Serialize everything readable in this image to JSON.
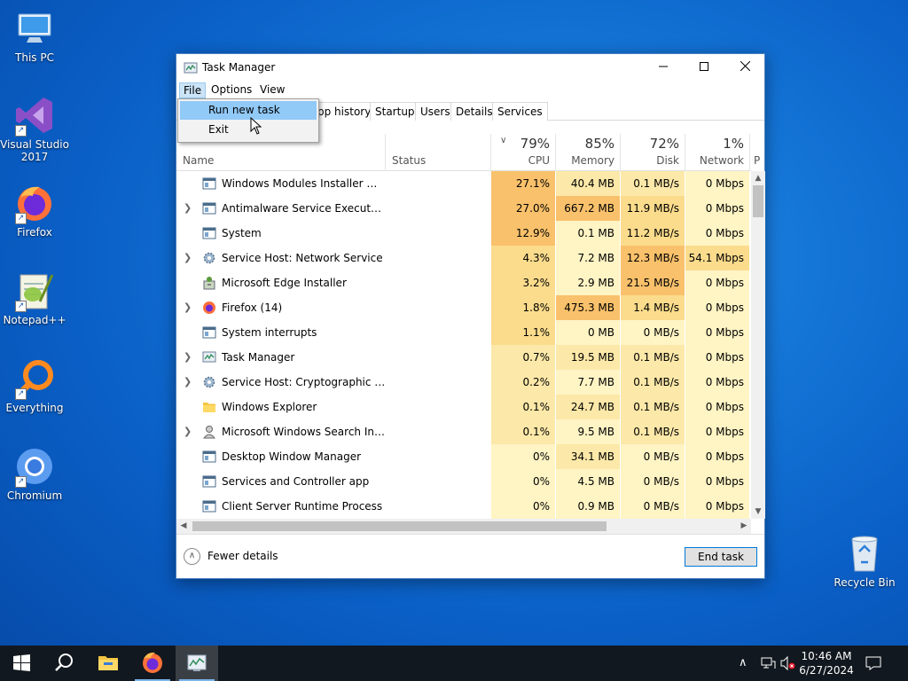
{
  "desktop": {
    "icons": [
      {
        "label": "This PC"
      },
      {
        "label": "Visual Studio 2017"
      },
      {
        "label": "Firefox"
      },
      {
        "label": "Notepad++"
      },
      {
        "label": "Everything"
      },
      {
        "label": "Chromium"
      },
      {
        "label": "Recycle Bin"
      }
    ]
  },
  "window": {
    "title": "Task Manager",
    "menu": {
      "file": "File",
      "options": "Options",
      "view": "View"
    },
    "tabs": [
      "pp history",
      "Startup",
      "Users",
      "Details",
      "Services"
    ],
    "columns": {
      "name": "Name",
      "status": "Status",
      "cpu": {
        "pct": "79%",
        "label": "CPU"
      },
      "memory": {
        "pct": "85%",
        "label": "Memory"
      },
      "disk": {
        "pct": "72%",
        "label": "Disk"
      },
      "network": {
        "pct": "1%",
        "label": "Network"
      },
      "power_partial": "P"
    },
    "processes": [
      {
        "name": "Windows Modules Installer Wor...",
        "expandable": false,
        "icon": "service-window-icon",
        "cpu": "27.1%",
        "memory": "40.4 MB",
        "disk": "0.1 MB/s",
        "network": "0 Mbps"
      },
      {
        "name": "Antimalware Service Executable",
        "expandable": true,
        "icon": "service-window-icon",
        "cpu": "27.0%",
        "memory": "667.2 MB",
        "disk": "11.9 MB/s",
        "network": "0 Mbps"
      },
      {
        "name": "System",
        "expandable": false,
        "icon": "service-window-icon",
        "cpu": "12.9%",
        "memory": "0.1 MB",
        "disk": "11.2 MB/s",
        "network": "0 Mbps"
      },
      {
        "name": "Service Host: Network Service",
        "expandable": true,
        "icon": "gear-icon",
        "cpu": "4.3%",
        "memory": "7.2 MB",
        "disk": "12.3 MB/s",
        "network": "54.1 Mbps"
      },
      {
        "name": "Microsoft Edge Installer",
        "expandable": false,
        "icon": "installer-icon",
        "cpu": "3.2%",
        "memory": "2.9 MB",
        "disk": "21.5 MB/s",
        "network": "0 Mbps"
      },
      {
        "name": "Firefox (14)",
        "expandable": true,
        "icon": "firefox-icon",
        "cpu": "1.8%",
        "memory": "475.3 MB",
        "disk": "1.4 MB/s",
        "network": "0 Mbps"
      },
      {
        "name": "System interrupts",
        "expandable": false,
        "icon": "service-window-icon",
        "cpu": "1.1%",
        "memory": "0 MB",
        "disk": "0 MB/s",
        "network": "0 Mbps"
      },
      {
        "name": "Task Manager",
        "expandable": true,
        "icon": "task-manager-icon",
        "cpu": "0.7%",
        "memory": "19.5 MB",
        "disk": "0.1 MB/s",
        "network": "0 Mbps"
      },
      {
        "name": "Service Host: Cryptographic Ser...",
        "expandable": true,
        "icon": "gear-icon",
        "cpu": "0.2%",
        "memory": "7.7 MB",
        "disk": "0.1 MB/s",
        "network": "0 Mbps"
      },
      {
        "name": "Windows Explorer",
        "expandable": false,
        "icon": "folder-icon",
        "cpu": "0.1%",
        "memory": "24.7 MB",
        "disk": "0.1 MB/s",
        "network": "0 Mbps"
      },
      {
        "name": "Microsoft Windows Search Inde...",
        "expandable": true,
        "icon": "search-indexer-icon",
        "cpu": "0.1%",
        "memory": "9.5 MB",
        "disk": "0.1 MB/s",
        "network": "0 Mbps"
      },
      {
        "name": "Desktop Window Manager",
        "expandable": false,
        "icon": "service-window-icon",
        "cpu": "0%",
        "memory": "34.1 MB",
        "disk": "0 MB/s",
        "network": "0 Mbps"
      },
      {
        "name": "Services and Controller app",
        "expandable": false,
        "icon": "service-window-icon",
        "cpu": "0%",
        "memory": "4.5 MB",
        "disk": "0 MB/s",
        "network": "0 Mbps"
      },
      {
        "name": "Client Server Runtime Process",
        "expandable": false,
        "icon": "service-window-icon",
        "cpu": "0%",
        "memory": "0.9 MB",
        "disk": "0 MB/s",
        "network": "0 Mbps"
      }
    ],
    "footer": {
      "fewer_details": "Fewer details",
      "end_task": "End task"
    }
  },
  "file_menu": {
    "items": [
      "Run new task",
      "Exit"
    ],
    "highlighted": "Run new task"
  },
  "taskbar": {
    "time": "10:46 AM",
    "date": "6/27/2024"
  },
  "colors": {
    "heat_hot": "#f9c16b",
    "heat_mid": "#fbdc8c",
    "heat_warm": "#fce8a8",
    "heat_low": "#fff4c4",
    "accent": "#0078d7"
  }
}
